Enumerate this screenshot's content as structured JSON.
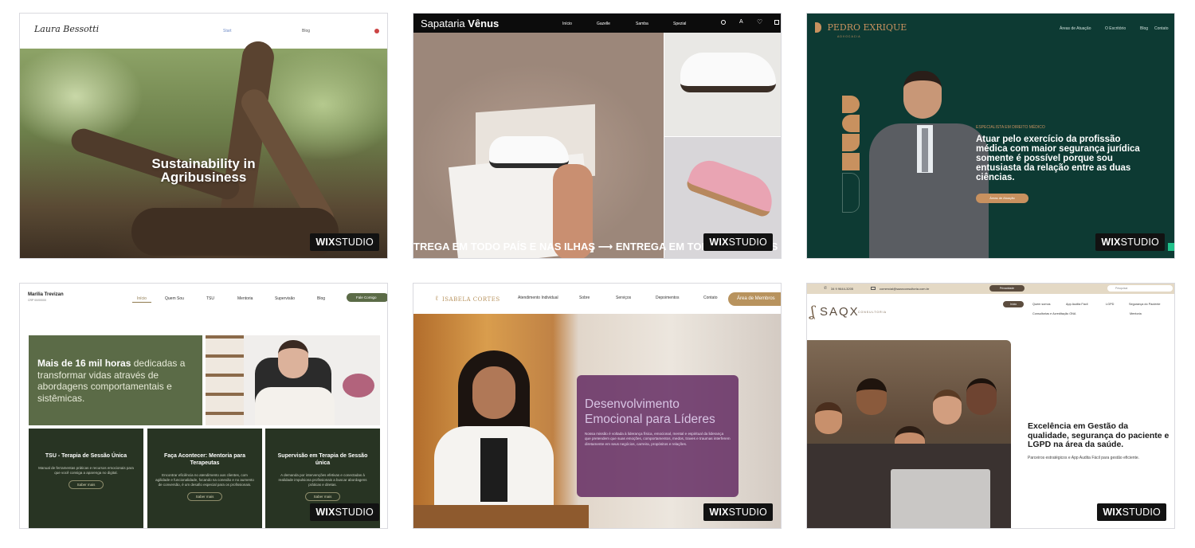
{
  "badge": {
    "wix": "WIX",
    "studio": "STUDIO"
  },
  "cards": [
    {
      "id": "sustainability",
      "logo": "Laura Bessotti",
      "nav": [
        "Start",
        "Blog"
      ],
      "headline_line1": "Sustainability in",
      "headline_line2": "Agribusiness"
    },
    {
      "id": "sapataria",
      "logo_light": "Sapataria ",
      "logo_bold": "Vênus",
      "nav": [
        "Início",
        "Gazelle",
        "Samba",
        "Spezial"
      ],
      "ticker": "TREGA EM TODO PAÍS E NAS ILHAS  ⟶  ENTREGA EM TODO PAÍS E NAS ILHAS"
    },
    {
      "id": "pedro",
      "logo": "PEDRO EXRIQUE",
      "logo_sub": "ADVOCACIA",
      "nav": [
        "Áreas de Atuação",
        "O Escritório",
        "Blog",
        "Contato"
      ],
      "eyebrow": "ESPECIALISTA EM DIREITO MÉDICO",
      "headline": "Atuar pelo exercício da profissão médica com maior segurança jurídica somente é possível porque sou entusiasta da relação entre as duas ciências.",
      "button": "Áreas de Atuação"
    },
    {
      "id": "marilia",
      "logo": "Marília Trevizan",
      "logo_sub": "CRP 00/00000",
      "nav": [
        "Início",
        "Quem Sou",
        "TSU",
        "Mentoria",
        "Supervisão",
        "Blog"
      ],
      "nav_button": "Fale Comigo",
      "hero_bold": "Mais de 16 mil horas",
      "hero_rest": " dedicadas a transformar vidas através de abordagens comportamentais e sistêmicas.",
      "boxes": [
        {
          "title": "TSU - Terapia de Sessão Única",
          "text": "Manual de ferramentas práticas e recursos emocionais para que você consiga a aparenga no digital.",
          "more": "Saber mais"
        },
        {
          "title": "Faça Acontecer: Mentoria para Terapeutas",
          "text": "Encontrar eficiência no atendimento aos clientes, com agilidade e funcionalidade, focando na conexão e no aumento de conversão, é um desafio especial para os profissionais.",
          "more": "Saber mais"
        },
        {
          "title": "Supervisão em Terapia de Sessão única",
          "text": "A demanda por intervenções efetivas e conectadas à realidade impulsiona profissionais a buscar abordagens práticas e diretas.",
          "more": "Saber mais"
        }
      ]
    },
    {
      "id": "isabela",
      "logo": "ISABELA CORTES",
      "nav": [
        "Atendimento Individual",
        "Sobre",
        "Serviços",
        "Depoimentos",
        "Contato"
      ],
      "nav_button": "Área de Membros",
      "panel_title": "Desenvolvimento Emocional para Líderes",
      "panel_text": "Nossa missão é voltada à liderança física, emocional, mental e espiritual da liderança que pretendem que suas emoções, comportamentos, medos, traves e traumas interferem diretamente em seus negócios, carreira, propósitos e relações."
    },
    {
      "id": "saax",
      "phone": "34 9 9644-3205",
      "email": "comercial@saaxconsultoria.com.br",
      "top_button": "Privacidade",
      "search": "Pesquisar",
      "logo": "SAQX",
      "logo_sub": "CONSULTORIA",
      "nav": [
        "Início",
        "Quem somos",
        "App Audita Fácil",
        "LGPD",
        "Segurança do Paciente"
      ],
      "nav2": [
        "Consultorias e Acreditação ONA",
        "Mentoria"
      ],
      "headline": "Excelência em Gestão da qualidade, segurança do paciente e LGPD na área da saúde.",
      "sub": "Parceiros estratégicos e App Audita Fácil para gestão eficiente."
    }
  ]
}
